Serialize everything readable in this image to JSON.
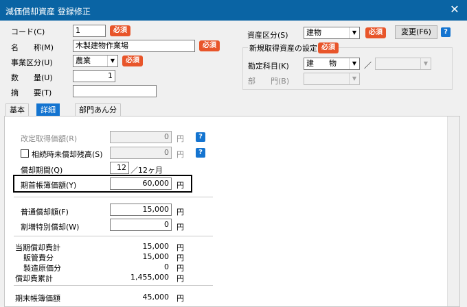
{
  "window": {
    "title": "減価償却資産 登録修正",
    "close": "✕"
  },
  "left": {
    "code_label": "コード(C)",
    "code_value": "1",
    "name_label": "名　　称(M)",
    "name_value": "木製建物作業場",
    "business_label": "事業区分(U)",
    "business_value": "農業",
    "qty_label": "数　　量(U)",
    "qty_value": "1",
    "summary_label": "摘　　要(T)",
    "summary_value": "",
    "required": "必須"
  },
  "right": {
    "asset_class_label": "資産区分(S)",
    "asset_class_value": "建物",
    "change_button": "変更(F6)",
    "new_asset_group": "新規取得資産の設定",
    "account_label": "勘定科目(K)",
    "account_value": "建　　物",
    "slash": "／",
    "dept_label": "部　　門(B)"
  },
  "tabs": [
    "基本",
    "詳細",
    "部門あん分"
  ],
  "detail": {
    "revised_cost_label": "改定取得価額(R)",
    "revised_cost_value": "0",
    "inherit_label": "相続時未償却残高(S)",
    "inherit_value": "0",
    "period_label": "償却期間(Q)",
    "period_value": "12",
    "period_suffix": "／12ヶ月",
    "opening_book_label": "期首帳簿価額(Y)",
    "opening_book_value": "60,000",
    "regular_dep_label": "普通償却額(F)",
    "regular_dep_value": "15,000",
    "special_dep_label": "割増特別償却(W)",
    "special_dep_value": "0",
    "current_total_label": "当期償却費計",
    "current_total_value": "15,000",
    "sga_label": "販管費分",
    "sga_value": "15,000",
    "mfg_label": "製造原価分",
    "mfg_value": "0",
    "accum_label": "償却費累計",
    "accum_value": "1,455,000",
    "closing_book_label": "期末帳簿価額",
    "closing_book_value": "45,000",
    "yen": "円",
    "help": "?"
  }
}
